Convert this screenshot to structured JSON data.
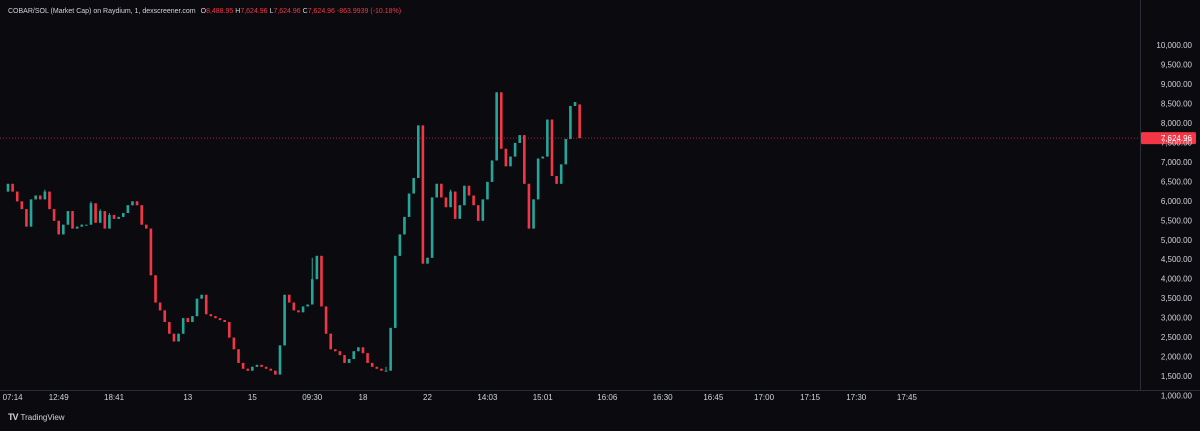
{
  "legend": {
    "symbol": "COBAR/SOL (Market Cap) on Raydium, 1, dexscreener.com",
    "o_key": "O",
    "o_val": "8,488.95",
    "h_key": "H",
    "h_val": "7,624.96",
    "l_key": "L",
    "l_val": "7,624.96",
    "c_key": "C",
    "c_val": "7,624.96",
    "change": "-863.9939 (-10.18%)"
  },
  "branding": {
    "text": "TradingView",
    "mark": "TV"
  },
  "colors": {
    "background": "#0b0b0f",
    "up": "#26a69a",
    "down": "#f23645",
    "price_label": "#f23645",
    "text": "#d1d4dc"
  },
  "chart_data": {
    "type": "candlestick",
    "ylim": [
      800,
      10200
    ],
    "y_ticks": [
      1000,
      1500,
      2000,
      2500,
      3000,
      3500,
      4000,
      4500,
      5000,
      5500,
      6000,
      6500,
      7000,
      7500,
      8000,
      8500,
      9000,
      9500,
      10000
    ],
    "y_tick_labels": [
      "1,000.00",
      "1,500.00",
      "2,000.00",
      "2,500.00",
      "3,000.00",
      "3,500.00",
      "4,000.00",
      "4,500.00",
      "5,000.00",
      "5,500.00",
      "6,000.00",
      "6,500.00",
      "7,000.00",
      "7,500.00",
      "8,000.00",
      "8,500.00",
      "9,000.00",
      "9,500.00",
      "10,000.00"
    ],
    "x_ticks": [
      {
        "label": "07:14",
        "index": 1
      },
      {
        "label": "12:49",
        "index": 11
      },
      {
        "label": "18:41",
        "index": 23
      },
      {
        "label": "13",
        "index": 39
      },
      {
        "label": "15",
        "index": 53
      },
      {
        "label": "09:30",
        "index": 66
      },
      {
        "label": "18",
        "index": 77
      },
      {
        "label": "22",
        "index": 91
      },
      {
        "label": "14:03",
        "index": 104
      },
      {
        "label": "15:01",
        "index": 116
      },
      {
        "label": "16:06",
        "index": 130
      },
      {
        "label": "16:30",
        "index": 142
      },
      {
        "label": "16:45",
        "index": 153
      },
      {
        "label": "17:00",
        "index": 164
      },
      {
        "label": "17:15",
        "index": 174
      },
      {
        "label": "17:30",
        "index": 184
      },
      {
        "label": "17:45",
        "index": 195
      }
    ],
    "last_price": 7624.96,
    "last_price_label": "7,624.96",
    "candles": [
      [
        6250,
        6450,
        6250,
        6450
      ],
      [
        6450,
        6450,
        6250,
        6250
      ],
      [
        6250,
        6250,
        6000,
        6000
      ],
      [
        6000,
        6000,
        5800,
        5800
      ],
      [
        5800,
        5800,
        5350,
        5350
      ],
      [
        5350,
        6050,
        5350,
        6050
      ],
      [
        6050,
        6150,
        6050,
        6150
      ],
      [
        6150,
        6150,
        6050,
        6050
      ],
      [
        6050,
        6300,
        6050,
        6250
      ],
      [
        6250,
        6250,
        5800,
        5800
      ],
      [
        5800,
        5800,
        5500,
        5500
      ],
      [
        5500,
        5500,
        5150,
        5150
      ],
      [
        5150,
        5400,
        5150,
        5400
      ],
      [
        5400,
        5750,
        5400,
        5750
      ],
      [
        5750,
        5750,
        5300,
        5300
      ],
      [
        5300,
        5350,
        5300,
        5350
      ],
      [
        5350,
        5400,
        5350,
        5400
      ],
      [
        5400,
        5400,
        5400,
        5400
      ],
      [
        5400,
        6000,
        5400,
        5950
      ],
      [
        5950,
        5950,
        5450,
        5450
      ],
      [
        5450,
        5800,
        5450,
        5750
      ],
      [
        5750,
        5750,
        5300,
        5300
      ],
      [
        5300,
        5700,
        5300,
        5650
      ],
      [
        5650,
        5650,
        5550,
        5550
      ],
      [
        5550,
        5550,
        5600,
        5600
      ],
      [
        5600,
        5700,
        5600,
        5700
      ],
      [
        5700,
        5900,
        5700,
        5900
      ],
      [
        5900,
        6000,
        5900,
        6000
      ],
      [
        6000,
        6000,
        5900,
        5900
      ],
      [
        5900,
        5900,
        5400,
        5400
      ],
      [
        5400,
        5400,
        5300,
        5300
      ],
      [
        5300,
        5300,
        4100,
        4100
      ],
      [
        4100,
        4100,
        3400,
        3400
      ],
      [
        3400,
        3400,
        3200,
        3200
      ],
      [
        3200,
        3200,
        2900,
        2900
      ],
      [
        2900,
        2900,
        2600,
        2600
      ],
      [
        2600,
        2600,
        2400,
        2400
      ],
      [
        2400,
        2600,
        2400,
        2600
      ],
      [
        2600,
        3000,
        2600,
        3000
      ],
      [
        3000,
        3000,
        2900,
        2900
      ],
      [
        2900,
        3050,
        2900,
        3050
      ],
      [
        3050,
        3500,
        3050,
        3500
      ],
      [
        3500,
        3600,
        3500,
        3600
      ],
      [
        3600,
        3600,
        3100,
        3100
      ],
      [
        3100,
        3100,
        3050,
        3050
      ],
      [
        3050,
        3050,
        3000,
        3000
      ],
      [
        3000,
        3000,
        2950,
        2950
      ],
      [
        2950,
        2950,
        2900,
        2900
      ],
      [
        2900,
        2900,
        2500,
        2500
      ],
      [
        2500,
        2500,
        2200,
        2200
      ],
      [
        2200,
        2200,
        1850,
        1850
      ],
      [
        1850,
        1850,
        1700,
        1700
      ],
      [
        1700,
        1700,
        1650,
        1650
      ],
      [
        1650,
        1750,
        1650,
        1750
      ],
      [
        1750,
        1800,
        1750,
        1800
      ],
      [
        1800,
        1800,
        1750,
        1750
      ],
      [
        1750,
        1750,
        1700,
        1700
      ],
      [
        1700,
        1700,
        1650,
        1650
      ],
      [
        1650,
        1650,
        1550,
        1550
      ],
      [
        1550,
        2300,
        1550,
        2300
      ],
      [
        2300,
        3600,
        2300,
        3600
      ],
      [
        3600,
        3600,
        3400,
        3400
      ],
      [
        3400,
        3400,
        3200,
        3200
      ],
      [
        3200,
        3200,
        3150,
        3150
      ],
      [
        3150,
        3300,
        3150,
        3300
      ],
      [
        3300,
        3350,
        3300,
        3350
      ],
      [
        3350,
        4550,
        3350,
        4000
      ],
      [
        4000,
        4600,
        4000,
        4600
      ],
      [
        4600,
        4600,
        3300,
        3300
      ],
      [
        3300,
        3300,
        2600,
        2600
      ],
      [
        2600,
        2600,
        2200,
        2200
      ],
      [
        2200,
        2200,
        2150,
        2150
      ],
      [
        2150,
        2150,
        2050,
        2050
      ],
      [
        2050,
        2050,
        1850,
        1850
      ],
      [
        1850,
        1950,
        1850,
        1950
      ],
      [
        1950,
        2150,
        1950,
        2150
      ],
      [
        2150,
        2250,
        2150,
        2250
      ],
      [
        2250,
        2250,
        2100,
        2100
      ],
      [
        2100,
        2100,
        1850,
        1850
      ],
      [
        1850,
        1850,
        1750,
        1750
      ],
      [
        1750,
        1750,
        1700,
        1700
      ],
      [
        1700,
        1700,
        1650,
        1650
      ],
      [
        1650,
        1750,
        1650,
        1650
      ],
      [
        1650,
        2750,
        1650,
        2750
      ],
      [
        2750,
        4600,
        2750,
        4600
      ],
      [
        4600,
        5150,
        4600,
        5150
      ],
      [
        5150,
        5600,
        5150,
        5600
      ],
      [
        5600,
        6200,
        5600,
        6200
      ],
      [
        6200,
        6600,
        6200,
        6600
      ],
      [
        6600,
        7950,
        6600,
        7950
      ],
      [
        7950,
        7950,
        4400,
        4400
      ],
      [
        4400,
        4550,
        4400,
        4550
      ],
      [
        4550,
        6100,
        4550,
        6100
      ],
      [
        6100,
        6450,
        6100,
        6450
      ],
      [
        6450,
        6450,
        6100,
        6100
      ],
      [
        6100,
        6100,
        5850,
        5850
      ],
      [
        5850,
        6300,
        5850,
        6250
      ],
      [
        6250,
        6250,
        5550,
        5550
      ],
      [
        5550,
        5900,
        5550,
        5900
      ],
      [
        5900,
        6400,
        5900,
        6400
      ],
      [
        6400,
        6400,
        6150,
        6150
      ],
      [
        6150,
        6150,
        5900,
        5900
      ],
      [
        5900,
        5900,
        5500,
        5500
      ],
      [
        5500,
        6050,
        5500,
        6050
      ],
      [
        6050,
        6500,
        6050,
        6500
      ],
      [
        6500,
        7050,
        6500,
        7050
      ],
      [
        7050,
        8800,
        7050,
        8800
      ],
      [
        8800,
        8800,
        7350,
        7350
      ],
      [
        7350,
        7350,
        6900,
        6900
      ],
      [
        6900,
        7150,
        6900,
        7150
      ],
      [
        7150,
        7500,
        7150,
        7500
      ],
      [
        7500,
        7700,
        7500,
        7700
      ],
      [
        7700,
        7700,
        6450,
        6450
      ],
      [
        6450,
        6450,
        5300,
        5300
      ],
      [
        5300,
        6050,
        5300,
        6050
      ],
      [
        6050,
        7100,
        6050,
        7100
      ],
      [
        7100,
        7150,
        7100,
        7150
      ],
      [
        7150,
        8100,
        7150,
        8100
      ],
      [
        8100,
        8100,
        6650,
        6650
      ],
      [
        6650,
        6650,
        6450,
        6450
      ],
      [
        6450,
        6950,
        6450,
        6950
      ],
      [
        6950,
        7600,
        6950,
        7600
      ],
      [
        7600,
        8450,
        7600,
        8450
      ],
      [
        8450,
        8550,
        8450,
        8550
      ],
      [
        8488.95,
        8488.95,
        7624.96,
        7624.96
      ]
    ]
  }
}
